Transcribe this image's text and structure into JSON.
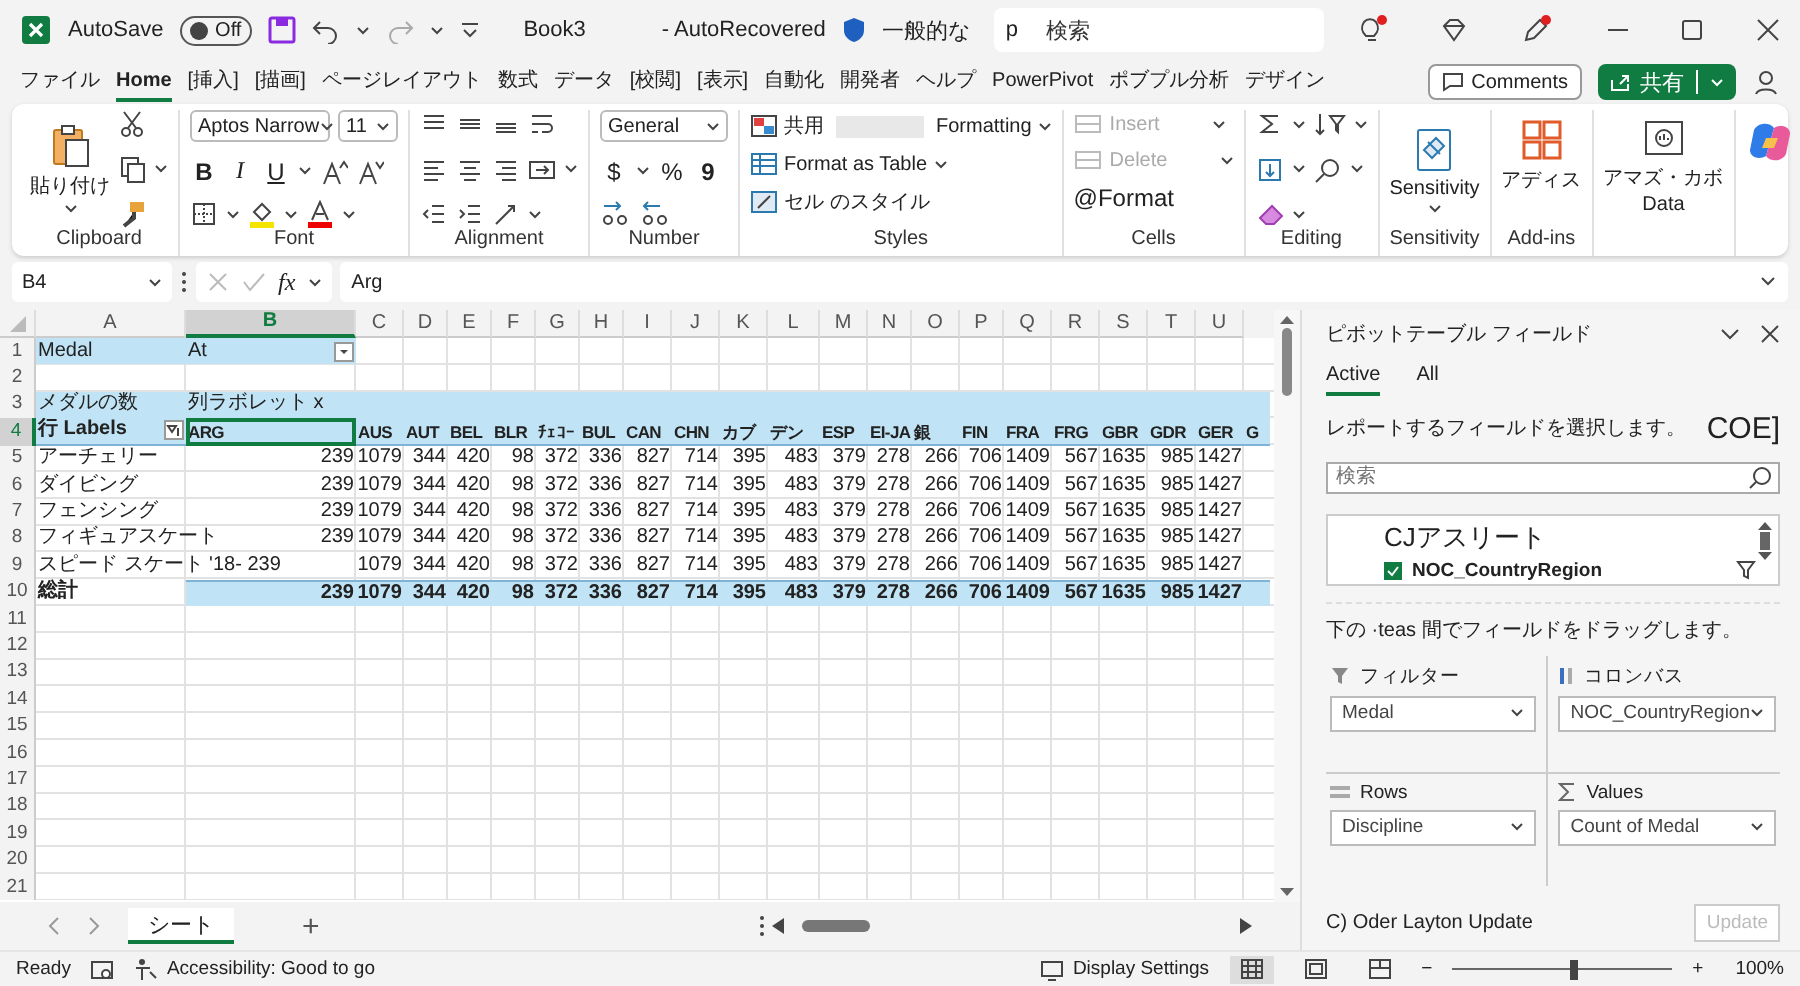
{
  "title_bar": {
    "autosave_label": "AutoSave",
    "autosave": {
      "label": "Off",
      "on": false
    },
    "file_name": "Book3",
    "status": "- AutoRecovered",
    "label": "一般的な",
    "search_prefix": "p",
    "search_placeholder": "検索"
  },
  "menu": {
    "tabs": [
      {
        "label": "ファイル",
        "selected": false
      },
      {
        "label": "Home",
        "selected": true
      },
      {
        "label": "[挿入]",
        "selected": false
      },
      {
        "label": "[描画]",
        "selected": false
      },
      {
        "label": "ページレイアウト",
        "selected": false
      },
      {
        "label": "数式",
        "selected": false
      },
      {
        "label": "データ",
        "selected": false
      },
      {
        "label": "[校閲]",
        "selected": false
      },
      {
        "label": "[表示]",
        "selected": false
      },
      {
        "label": "自動化",
        "selected": false
      },
      {
        "label": "開発者",
        "selected": false
      },
      {
        "label": "ヘルプ",
        "selected": false
      },
      {
        "label": "PowerPivot",
        "selected": false
      },
      {
        "label": "ポブプル分析",
        "selected": false
      },
      {
        "label": "デザイン",
        "selected": false
      }
    ],
    "comments": "Comments",
    "share": "共有"
  },
  "ribbon": {
    "groups": [
      {
        "kind": "clipboard",
        "label": "Clipboard",
        "paste": "貼り付け"
      },
      {
        "kind": "font",
        "label": "Font",
        "font": "Aptos Narrow",
        "size": "11",
        "bold": "B",
        "italic": "I",
        "underline": "U"
      },
      {
        "kind": "alignment",
        "label": "Alignment"
      },
      {
        "kind": "number",
        "label": "Number",
        "format": "General",
        "currency": "$",
        "percent": "%",
        "comma": "9"
      },
      {
        "kind": "styles",
        "label": "Styles",
        "conditional": "共用",
        "formatting": "Formatting",
        "table": "Format as Table",
        "cell_styles": "セル のスタイル"
      },
      {
        "kind": "cells",
        "label": "Cells",
        "items": [
          {
            "label": "Insert",
            "disabled": true
          },
          {
            "label": "Delete",
            "disabled": true
          },
          {
            "label": "@Format",
            "disabled": false
          }
        ]
      },
      {
        "kind": "editing",
        "label": "Editing"
      },
      {
        "kind": "sensitivity",
        "label": "Sensitivity",
        "button": "Sensitivity"
      },
      {
        "kind": "addins",
        "label": "Add-ins",
        "button": "アディス"
      },
      {
        "kind": "data",
        "button": "アマズ・カボ",
        "sub": "Data"
      },
      {
        "kind": "copilot"
      }
    ]
  },
  "formula_bar": {
    "name_box": "B4",
    "fx": "fx",
    "formula": "Arg"
  },
  "sheet": {
    "columns": [
      {
        "label": "A",
        "selected": false
      },
      {
        "label": "B",
        "selected": true
      },
      {
        "label": "C",
        "selected": false
      },
      {
        "label": "D",
        "selected": false
      },
      {
        "label": "E",
        "selected": false
      },
      {
        "label": "F",
        "selected": false
      },
      {
        "label": "G",
        "selected": false
      },
      {
        "label": "H",
        "selected": false
      },
      {
        "label": "I",
        "selected": false
      },
      {
        "label": "J",
        "selected": false
      },
      {
        "label": "K",
        "selected": false
      },
      {
        "label": "L",
        "selected": false
      },
      {
        "label": "M",
        "selected": false
      },
      {
        "label": "N",
        "selected": false
      },
      {
        "label": "O",
        "selected": false
      },
      {
        "label": "P",
        "selected": false
      },
      {
        "label": "Q",
        "selected": false
      },
      {
        "label": "R",
        "selected": false
      },
      {
        "label": "S",
        "selected": false
      },
      {
        "label": "T",
        "selected": false
      },
      {
        "label": "U",
        "selected": false
      }
    ],
    "rows": [
      {
        "label": "1",
        "selected": false
      },
      {
        "label": "2",
        "selected": false
      },
      {
        "label": "3",
        "selected": false
      },
      {
        "label": "4",
        "selected": true
      },
      {
        "label": "5",
        "selected": false
      },
      {
        "label": "6",
        "selected": false
      },
      {
        "label": "7",
        "selected": false
      },
      {
        "label": "8",
        "selected": false
      },
      {
        "label": "9",
        "selected": false
      },
      {
        "label": "10",
        "selected": false
      },
      {
        "label": "11",
        "selected": false
      },
      {
        "label": "12",
        "selected": false
      },
      {
        "label": "13",
        "selected": false
      },
      {
        "label": "14",
        "selected": false
      },
      {
        "label": "15",
        "selected": false
      },
      {
        "label": "16",
        "selected": false
      },
      {
        "label": "17",
        "selected": false
      },
      {
        "label": "18",
        "selected": false
      },
      {
        "label": "19",
        "selected": false
      },
      {
        "label": "20",
        "selected": false
      },
      {
        "label": "21",
        "selected": false
      }
    ],
    "filter": {
      "field": "Medal",
      "value": "At"
    },
    "values_label": "メダルの数",
    "columns_label": "列ラボレット x",
    "rows_label": "行 Labels",
    "column_headers": [
      "ARG",
      "AUS",
      "AUT",
      "BEL",
      "BLR",
      "ﾁｪｺｰ",
      "BUL",
      "CAN",
      "CHN",
      "カブ",
      "デン",
      "ESP",
      "EI-JA",
      "銀",
      "FIN",
      "FRA",
      "FRG",
      "GBR",
      "GDR",
      "GER",
      "G"
    ],
    "data_rows": [
      {
        "label": "アーチェリー",
        "values": [
          "239",
          "1079",
          "344",
          "420",
          "98",
          "372",
          "336",
          "827",
          "714",
          "395",
          "483",
          "379",
          "278",
          "266",
          "706",
          "1409",
          "567",
          "1635",
          "985",
          "1427"
        ]
      },
      {
        "label": "ダイビング",
        "values": [
          "239",
          "1079",
          "344",
          "420",
          "98",
          "372",
          "336",
          "827",
          "714",
          "395",
          "483",
          "379",
          "278",
          "266",
          "706",
          "1409",
          "567",
          "1635",
          "985",
          "1427"
        ]
      },
      {
        "label": "フェンシング",
        "values": [
          "239",
          "1079",
          "344",
          "420",
          "98",
          "372",
          "336",
          "827",
          "714",
          "395",
          "483",
          "379",
          "278",
          "266",
          "706",
          "1409",
          "567",
          "1635",
          "985",
          "1427"
        ]
      },
      {
        "label": "フィギュアスケート",
        "values": [
          "239",
          "1079",
          "344",
          "420",
          "98",
          "372",
          "336",
          "827",
          "714",
          "395",
          "483",
          "379",
          "278",
          "266",
          "706",
          "1409",
          "567",
          "1635",
          "985",
          "1427"
        ]
      },
      {
        "label": "スピード スケート '18- 239",
        "blank_first": true,
        "values": [
          "1079",
          "344",
          "420",
          "98",
          "372",
          "336",
          "827",
          "714",
          "395",
          "483",
          "379",
          "278",
          "266",
          "706",
          "1409",
          "567",
          "1635",
          "985",
          "1427"
        ]
      }
    ],
    "total": {
      "label": "総計",
      "values": [
        "239",
        "1079",
        "344",
        "420",
        "98",
        "372",
        "336",
        "827",
        "714",
        "395",
        "483",
        "379",
        "278",
        "266",
        "706",
        "1409",
        "567",
        "1635",
        "985",
        "1427"
      ]
    }
  },
  "sheet_tabs": {
    "tabs": [
      {
        "label": "シート",
        "selected": true
      }
    ],
    "add": "+"
  },
  "pivot_panel": {
    "title": "ピボットテーブル フィールド",
    "tabs": [
      {
        "label": "Active",
        "selected": true
      },
      {
        "label": "All",
        "selected": false
      }
    ],
    "instruction": "レポートするフィールドを選択します。",
    "badge": "COE]",
    "search_placeholder": "検索",
    "fields": [
      {
        "kind": "group",
        "label": "CJアスリート"
      },
      {
        "kind": "field",
        "label": "NOC_CountryRegion",
        "checked": true,
        "filtered": true
      }
    ],
    "drag_hint": "下の ·teas 間でフィールドをドラッグします。",
    "areas": [
      {
        "kind": "filter",
        "title": "フィルター",
        "value": "Medal"
      },
      {
        "kind": "columns",
        "title": "コロンバス",
        "value": "NOC_CountryRegion"
      },
      {
        "kind": "rows",
        "title": "Rows",
        "value": "Discipline"
      },
      {
        "kind": "values",
        "title": "Values",
        "value": "Count of Medal"
      }
    ],
    "defer_label": "C) Oder Layton Update",
    "update": {
      "label": "Update",
      "disabled": true
    }
  },
  "status_bar": {
    "ready": "Ready",
    "accessibility": "Accessibility: Good to go",
    "display_settings": "Display Settings",
    "views": [
      {
        "kind": "normal",
        "selected": true
      },
      {
        "kind": "page_layout",
        "selected": false
      },
      {
        "kind": "page_break",
        "selected": false
      }
    ],
    "zoom_out": "−",
    "zoom_in": "+",
    "zoom": {
      "level": 0.55,
      "label": "100%"
    }
  }
}
